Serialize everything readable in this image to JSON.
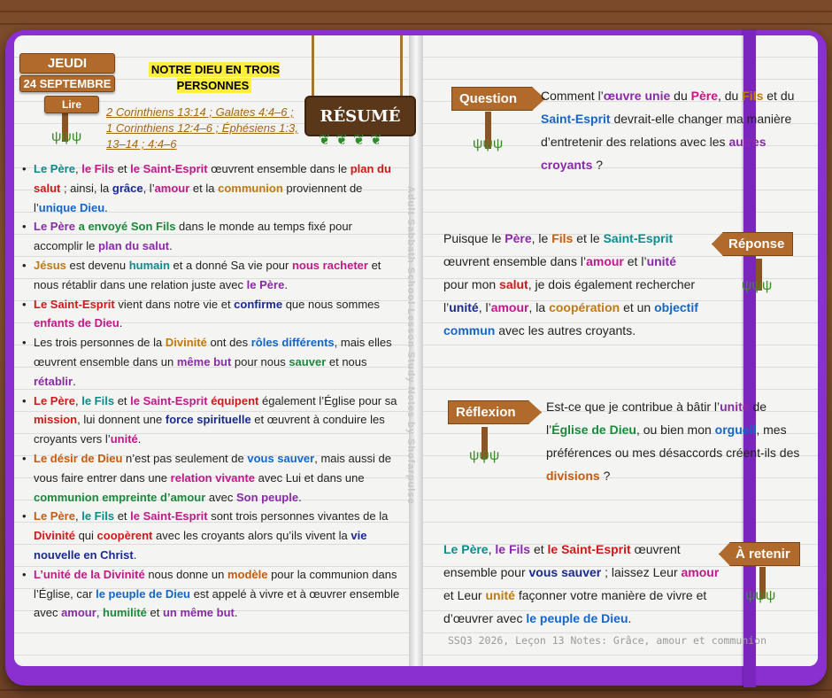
{
  "header": {
    "day": "JEUDI",
    "date": "24 SEPTEMBRE",
    "read_label": "Lire",
    "title": "NOTRE DIEU EN TROIS PERSONNES",
    "references": "2 Corinthiens 13:14 ; Galates 4:4–6 ; 1 Corinthiens 12:4–6 ; Éphésiens 1:3, 13–14 ; 4:4–6",
    "resume_label": "RÉSUMÉ"
  },
  "bullets": [
    [
      [
        "Le Père",
        "teal"
      ],
      [
        ", ",
        ""
      ],
      [
        "le Fils",
        "mag"
      ],
      [
        " et ",
        ""
      ],
      [
        "le Saint-Esprit",
        "mag"
      ],
      [
        " œuvrent ensemble dans le ",
        ""
      ],
      [
        "plan du salut",
        "red"
      ],
      [
        " ; ainsi, la ",
        ""
      ],
      [
        "grâce",
        "navy"
      ],
      [
        ", l’",
        ""
      ],
      [
        "amour",
        "mag"
      ],
      [
        " et la ",
        ""
      ],
      [
        "communion",
        "orange"
      ],
      [
        " proviennent de l’",
        ""
      ],
      [
        "unique Dieu",
        "blue"
      ],
      [
        ".",
        ""
      ]
    ],
    [
      [
        "Le Père",
        "purple"
      ],
      [
        " ",
        ""
      ],
      [
        "a envoyé Son Fils",
        "green"
      ],
      [
        " dans le monde au temps fixé pour accomplir le ",
        ""
      ],
      [
        "plan du salut",
        "purple"
      ],
      [
        ".",
        ""
      ]
    ],
    [
      [
        "Jésus",
        "orange"
      ],
      [
        " est devenu ",
        ""
      ],
      [
        "humain",
        "teal"
      ],
      [
        " et a donné Sa vie pour ",
        ""
      ],
      [
        "nous racheter",
        "mag"
      ],
      [
        " et nous rétablir dans une relation juste avec ",
        ""
      ],
      [
        "le Père",
        "purple"
      ],
      [
        ".",
        ""
      ]
    ],
    [
      [
        "Le Saint-Esprit",
        "red"
      ],
      [
        " vient dans notre vie et ",
        ""
      ],
      [
        "confirme",
        "navy"
      ],
      [
        " que nous sommes ",
        ""
      ],
      [
        "enfants de Dieu",
        "mag"
      ],
      [
        ".",
        ""
      ]
    ],
    [
      [
        "Les trois personnes de la ",
        ""
      ],
      [
        "Divinité",
        "orange"
      ],
      [
        " ont des ",
        ""
      ],
      [
        "rôles différents",
        "blue"
      ],
      [
        ", mais elles œuvrent ensemble dans un ",
        ""
      ],
      [
        "même but",
        "purple"
      ],
      [
        " pour nous ",
        ""
      ],
      [
        "sauver",
        "green"
      ],
      [
        " et nous ",
        ""
      ],
      [
        "rétablir",
        "purple"
      ],
      [
        ".",
        ""
      ]
    ],
    [
      [
        "Le Père",
        "red"
      ],
      [
        ", ",
        ""
      ],
      [
        "le Fils",
        "teal"
      ],
      [
        " et ",
        ""
      ],
      [
        "le Saint-Esprit",
        "mag"
      ],
      [
        " ",
        ""
      ],
      [
        "équipent",
        "red"
      ],
      [
        " également l’Église pour sa ",
        ""
      ],
      [
        "mission",
        "red"
      ],
      [
        ", lui donnent une ",
        ""
      ],
      [
        "force spirituelle",
        "navy"
      ],
      [
        " et œuvrent à conduire les croyants vers l’",
        ""
      ],
      [
        "unité",
        "mag"
      ],
      [
        ".",
        ""
      ]
    ],
    [
      [
        "Le désir de Dieu",
        "brown"
      ],
      [
        " n’est pas seulement de ",
        ""
      ],
      [
        "vous sauver",
        "blue"
      ],
      [
        ", mais aussi de vous faire entrer dans une ",
        ""
      ],
      [
        "relation vivante",
        "mag"
      ],
      [
        " avec Lui et dans une ",
        ""
      ],
      [
        "communion empreinte d’amour",
        "green"
      ],
      [
        " avec ",
        ""
      ],
      [
        "Son peuple",
        "purple"
      ],
      [
        ".",
        ""
      ]
    ],
    [
      [
        "Le Père",
        "brown"
      ],
      [
        ", ",
        ""
      ],
      [
        "le Fils",
        "teal"
      ],
      [
        " et ",
        ""
      ],
      [
        "le Saint-Esprit",
        "mag"
      ],
      [
        " sont trois personnes vivantes de la ",
        ""
      ],
      [
        "Divinité",
        "red"
      ],
      [
        " qui ",
        ""
      ],
      [
        "coopèrent",
        "red"
      ],
      [
        " avec les croyants alors qu’ils vivent la ",
        ""
      ],
      [
        "vie nouvelle en Christ",
        "navy"
      ],
      [
        ".",
        ""
      ]
    ],
    [
      [
        "L’unité de la Divinité",
        "mag"
      ],
      [
        " nous donne un ",
        ""
      ],
      [
        "modèle",
        "brown"
      ],
      [
        " pour la communion dans l’Église, car ",
        ""
      ],
      [
        "le peuple de Dieu",
        "blue"
      ],
      [
        " est appelé à vivre et à œuvrer ensemble avec ",
        ""
      ],
      [
        "amour",
        "purple"
      ],
      [
        ", ",
        ""
      ],
      [
        "humilité",
        "green"
      ],
      [
        " et ",
        ""
      ],
      [
        "un même but",
        "purple"
      ],
      [
        ".",
        ""
      ]
    ]
  ],
  "watermark": "Adult Sabbath School Lesson Study Notes by Shofarpulse",
  "question": {
    "label": "Question",
    "text": [
      [
        "Comment l’",
        ""
      ],
      [
        "œuvre unie",
        "purple"
      ],
      [
        " du ",
        ""
      ],
      [
        "Père",
        "mag"
      ],
      [
        ", du ",
        ""
      ],
      [
        "Fils",
        "orange"
      ],
      [
        " et du ",
        ""
      ],
      [
        "Saint-Esprit",
        "blue"
      ],
      [
        " devrait-elle changer ma manière d’entretenir des relations avec les ",
        ""
      ],
      [
        "autres croyants",
        "purple"
      ],
      [
        " ?",
        ""
      ]
    ]
  },
  "reponse": {
    "label": "Réponse",
    "text": [
      [
        "Puisque le ",
        ""
      ],
      [
        "Père",
        "purple"
      ],
      [
        ", le ",
        ""
      ],
      [
        "Fils",
        "brown"
      ],
      [
        " et le ",
        ""
      ],
      [
        "Saint-Esprit",
        "teal"
      ],
      [
        " œuvrent ensemble dans l’",
        ""
      ],
      [
        "amour",
        "mag"
      ],
      [
        " et l’",
        ""
      ],
      [
        "unité",
        "purple"
      ],
      [
        " pour mon ",
        ""
      ],
      [
        "salut",
        "red"
      ],
      [
        ", je dois également rechercher l’",
        ""
      ],
      [
        "unité",
        "navy"
      ],
      [
        ", l’",
        ""
      ],
      [
        "amour",
        "mag"
      ],
      [
        ", la ",
        ""
      ],
      [
        "coopération",
        "orange"
      ],
      [
        " et un ",
        ""
      ],
      [
        "objectif commun",
        "blue"
      ],
      [
        " avec les autres croyants.",
        ""
      ]
    ]
  },
  "reflexion": {
    "label": "Réflexion",
    "text": [
      [
        "Est-ce que je contribue à bâtir l’",
        ""
      ],
      [
        "unité",
        "purple"
      ],
      [
        " de l’",
        ""
      ],
      [
        "Église de Dieu",
        "green"
      ],
      [
        ", ou bien mon ",
        ""
      ],
      [
        "orgueil",
        "blue"
      ],
      [
        ", mes préférences ou mes désaccords créent-ils des ",
        ""
      ],
      [
        "divisions",
        "brown"
      ],
      [
        " ?",
        ""
      ]
    ]
  },
  "retenir": {
    "label": "À retenir",
    "text": [
      [
        "Le Père",
        "teal"
      ],
      [
        ", ",
        ""
      ],
      [
        "le Fils",
        "purple"
      ],
      [
        " et ",
        ""
      ],
      [
        "le Saint-Esprit",
        "red"
      ],
      [
        " œuvrent ensemble pour ",
        ""
      ],
      [
        "vous sauver",
        "navy"
      ],
      [
        " ; laissez Leur ",
        ""
      ],
      [
        "amour",
        "mag"
      ],
      [
        " et Leur ",
        ""
      ],
      [
        "unité",
        "orange"
      ],
      [
        " façonner votre manière de vivre et d’œuvrer avec ",
        ""
      ],
      [
        "le peuple de Dieu",
        "blue"
      ],
      [
        ".",
        ""
      ]
    ]
  },
  "footer": "SSQ3 2026, Leçon 13 Notes: Grâce, amour et communion",
  "icons": [
    "signpost-icon",
    "grass-icon",
    "leaves-icon"
  ]
}
